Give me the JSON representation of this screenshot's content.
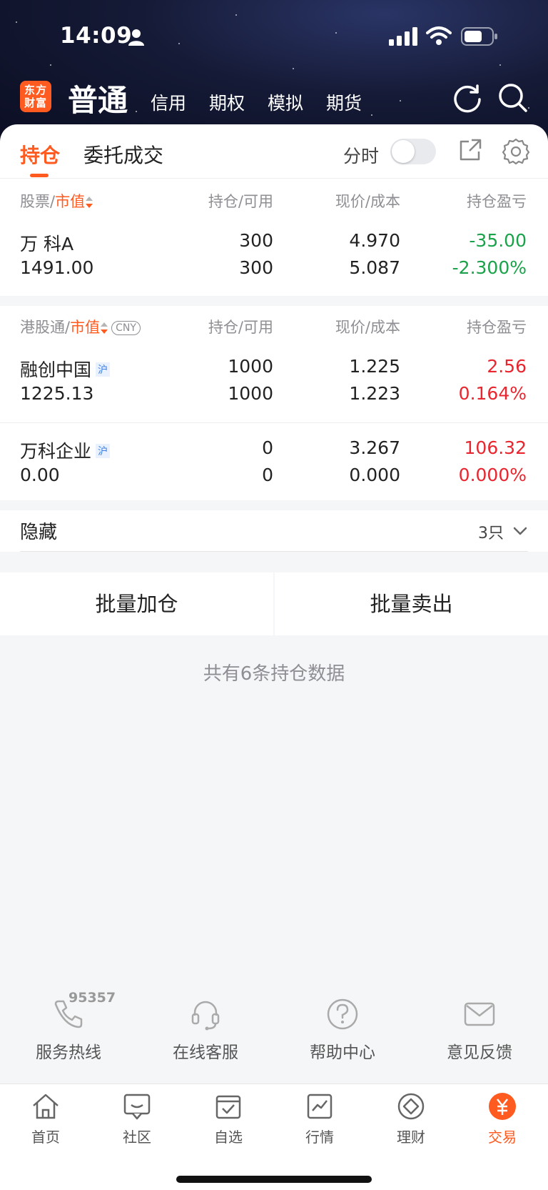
{
  "status": {
    "time": "14:09"
  },
  "top": {
    "logo": "东方财富",
    "main": "普通",
    "subs": [
      "信用",
      "期权",
      "模拟",
      "期货"
    ]
  },
  "tabs": {
    "active": "持仓",
    "other": "委托成交",
    "fenshi": "分时",
    "fenshi_on": false
  },
  "a_share": {
    "header": {
      "stock": "股票",
      "sort_field": "市值",
      "pos": "持仓/可用",
      "price": "现价/成本",
      "pnl": "持仓盈亏"
    },
    "rows": [
      {
        "name": "万 科A",
        "mkt_value": "1491.00",
        "hold": "300",
        "avail": "300",
        "price": "4.970",
        "cost": "5.087",
        "pnl": "-35.00",
        "pnl_pct": "-2.300%"
      }
    ]
  },
  "hk_connect": {
    "header": {
      "stock": "港股通",
      "sort_field": "市值",
      "currency": "CNY",
      "pos": "持仓/可用",
      "price": "现价/成本",
      "pnl": "持仓盈亏"
    },
    "rows": [
      {
        "name": "融创中国",
        "market": "沪",
        "mkt_value": "1225.13",
        "hold": "1000",
        "avail": "1000",
        "price": "1.225",
        "cost": "1.223",
        "pnl": "2.56",
        "pnl_pct": "0.164%"
      },
      {
        "name": "万科企业",
        "market": "沪",
        "mkt_value": "0.00",
        "hold": "0",
        "avail": "0",
        "price": "3.267",
        "cost": "0.000",
        "pnl": "106.32",
        "pnl_pct": "0.000%"
      }
    ]
  },
  "hidden": {
    "label": "隐藏",
    "count": "3只"
  },
  "batch": {
    "add": "批量加仓",
    "sell": "批量卖出"
  },
  "total_text": "共有6条持仓数据",
  "services": [
    {
      "label": "服务热线",
      "icon": "phone-icon",
      "tag": "95357"
    },
    {
      "label": "在线客服",
      "icon": "headset-icon"
    },
    {
      "label": "帮助中心",
      "icon": "help-icon"
    },
    {
      "label": "意见反馈",
      "icon": "mail-icon"
    }
  ],
  "tabbar": [
    {
      "label": "首页",
      "icon": "home-icon"
    },
    {
      "label": "社区",
      "icon": "community-icon"
    },
    {
      "label": "自选",
      "icon": "watchlist-icon"
    },
    {
      "label": "行情",
      "icon": "market-icon"
    },
    {
      "label": "理财",
      "icon": "wealth-icon"
    },
    {
      "label": "交易",
      "icon": "trade-icon",
      "active": true
    }
  ],
  "colors": {
    "accent": "#ff5a1f",
    "up": "#e8262f",
    "down": "#1aa34a"
  }
}
